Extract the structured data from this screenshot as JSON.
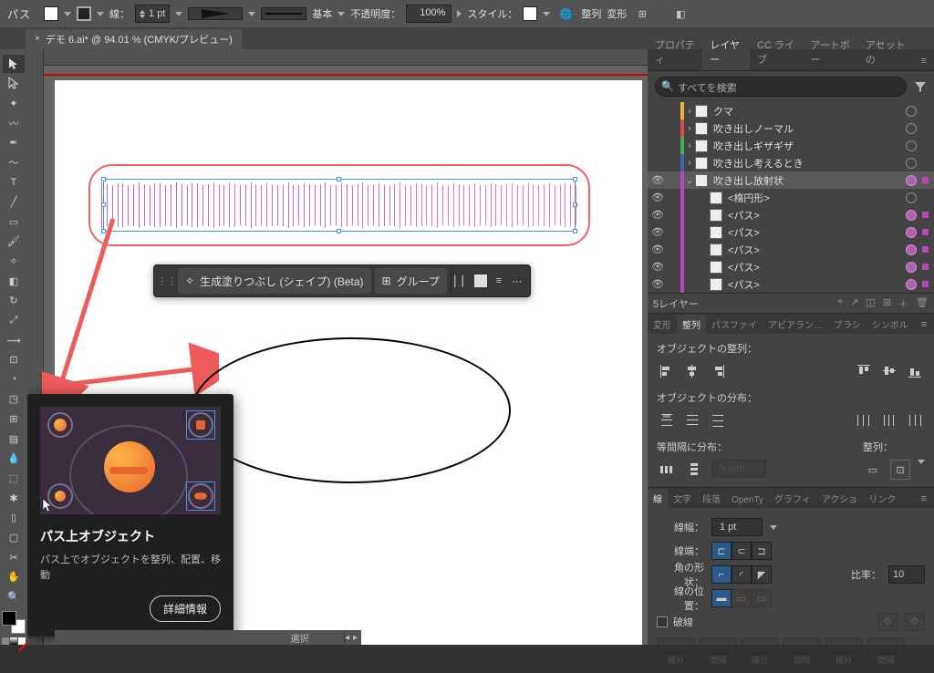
{
  "topbar": {
    "mode": "パス",
    "stroke_label": "線：",
    "stroke_width": "1 pt",
    "profile": "基本",
    "opacity_label": "不透明度：",
    "opacity": "100%",
    "style_label": "スタイル：",
    "align_btn": "整列",
    "transform_btn": "変形"
  },
  "tab": {
    "title": "デモ 6.ai* @ 94.01 % (CMYK/プレビュー)"
  },
  "ctx": {
    "gen_fill": "生成塗りつぶし (シェイプ) (Beta)",
    "group": "グループ"
  },
  "tooltip": {
    "title": "パス上オブジェクト",
    "desc": "パス上でオブジェクトを整列、配置、移動",
    "btn": "詳細情報"
  },
  "status": {
    "select_label": "選択"
  },
  "right": {
    "tabs": {
      "prop": "プロパティ",
      "layers": "レイヤー",
      "cclib": "CC ライブ",
      "artbd": "アートボー",
      "asset": "アセットの"
    },
    "search_ph": "すべてを検索",
    "layers": [
      {
        "color": "#e8b43a",
        "vis": "",
        "depth": 0,
        "arrow": "›",
        "name": "クマ",
        "sel": false,
        "hl": false
      },
      {
        "color": "#d94a4a",
        "vis": "",
        "depth": 0,
        "arrow": "›",
        "name": "吹き出しノーマル",
        "sel": false,
        "hl": false
      },
      {
        "color": "#3fb24a",
        "vis": "",
        "depth": 0,
        "arrow": "›",
        "name": "吹き出しギザギザ",
        "sel": false,
        "hl": false
      },
      {
        "color": "#3f66b2",
        "vis": "",
        "depth": 0,
        "arrow": "›",
        "name": "吹き出し考えるとき",
        "sel": false,
        "hl": false
      },
      {
        "color": "#b946b9",
        "vis": "👁",
        "depth": 0,
        "arrow": "⌄",
        "name": "吹き出し放射状",
        "sel": false,
        "hl": true,
        "selbox": true,
        "rowsel": true
      },
      {
        "color": "#b946b9",
        "vis": "👁",
        "depth": 1,
        "arrow": "",
        "name": "<楕円形>",
        "sel": false,
        "hl": false
      },
      {
        "color": "#b946b9",
        "vis": "👁",
        "depth": 1,
        "arrow": "",
        "name": "<パス>",
        "sel": true,
        "hl": true,
        "selbox": true
      },
      {
        "color": "#b946b9",
        "vis": "👁",
        "depth": 1,
        "arrow": "",
        "name": "<パス>",
        "sel": true,
        "hl": true,
        "selbox": true
      },
      {
        "color": "#b946b9",
        "vis": "👁",
        "depth": 1,
        "arrow": "",
        "name": "<パス>",
        "sel": true,
        "hl": true,
        "selbox": true
      },
      {
        "color": "#b946b9",
        "vis": "👁",
        "depth": 1,
        "arrow": "",
        "name": "<パス>",
        "sel": true,
        "hl": true,
        "selbox": true
      },
      {
        "color": "#b946b9",
        "vis": "👁",
        "depth": 1,
        "arrow": "",
        "name": "<パス>",
        "sel": true,
        "hl": true,
        "selbox": true
      }
    ],
    "layer_footer": "5レイヤー",
    "align_tabs": {
      "transform": "変形",
      "align": "整列",
      "pathfinder": "パスファイ",
      "appearance": "アピアラン…",
      "brushes": "ブラシ",
      "symbols": "シンボル"
    },
    "align": {
      "obj_align": "オブジェクトの整列：",
      "obj_dist": "オブジェクトの分布：",
      "equal_dist": "等間隔に分布：",
      "align_to": "整列："
    },
    "stroke_tabs": {
      "stroke": "線",
      "char": "文字",
      "para": "段落",
      "opentype": "OpenTy",
      "graphic": "グラフィ",
      "action": "アクショ",
      "link": "リンク"
    },
    "stroke": {
      "width_lb": "線幅：",
      "width": "1 pt",
      "cap_lb": "線端：",
      "corner_lb": "角の形状：",
      "ratio_lb": "比率：",
      "ratio": "10",
      "pos_lb": "線の位置：",
      "dash_lb": "破線",
      "dash_cells": [
        "線分",
        "間隔",
        "線分",
        "間隔",
        "線分",
        "間隔"
      ]
    }
  }
}
